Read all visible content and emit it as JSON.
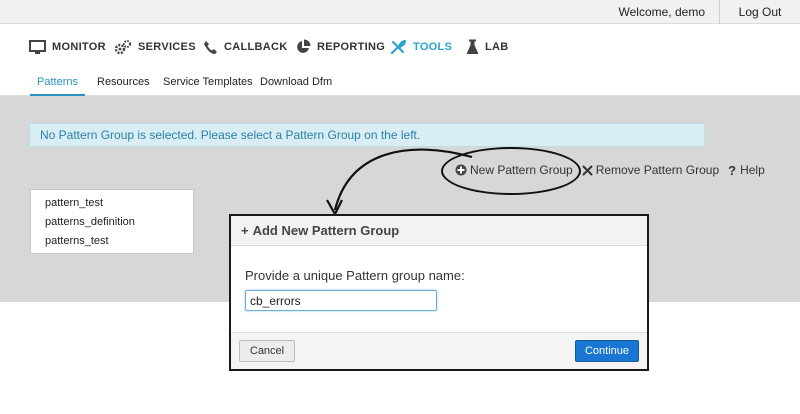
{
  "topbar": {
    "welcome": "Welcome, demo",
    "logout": "Log Out"
  },
  "mainnav": [
    {
      "label": "MONITOR",
      "icon": "monitor-icon"
    },
    {
      "label": "SERVICES",
      "icon": "gears-icon"
    },
    {
      "label": "CALLBACK",
      "icon": "phone-icon"
    },
    {
      "label": "REPORTING",
      "icon": "pie-chart-icon"
    },
    {
      "label": "TOOLS",
      "icon": "wrench-icon",
      "active": true
    },
    {
      "label": "LAB",
      "icon": "flask-icon"
    }
  ],
  "subnav": [
    {
      "label": "Patterns",
      "active": true
    },
    {
      "label": "Resources"
    },
    {
      "label": "Service Templates"
    },
    {
      "label": "Download Dfm"
    }
  ],
  "alert": "No Pattern Group is selected. Please select a Pattern Group on the left.",
  "actions": {
    "new_group": "New Pattern Group",
    "remove_group": "Remove Pattern Group",
    "help": "Help"
  },
  "pattern_groups": [
    "pattern_test",
    "patterns_definition",
    "patterns_test"
  ],
  "modal": {
    "title": "Add New Pattern Group",
    "prompt": "Provide a unique Pattern group name:",
    "input_value": "cb_errors",
    "cancel": "Cancel",
    "continue": "Continue"
  },
  "colors": {
    "accent": "#2aa4cf",
    "primary_button": "#1976d2",
    "alert_bg": "#d9edf5",
    "alert_text": "#2c80a8"
  }
}
